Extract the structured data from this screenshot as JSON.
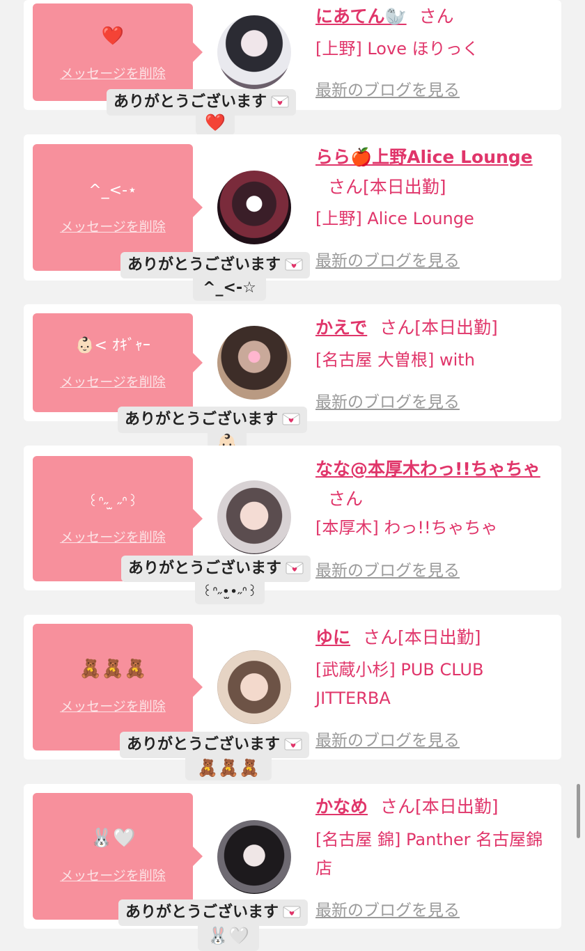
{
  "delete_label": "メッセージを削除",
  "san": "さん",
  "blog_label": "最新のブログを見る",
  "thanks_label": "ありがとうございます",
  "colors": {
    "accent": "#e0356a",
    "bubble": "#f7909c",
    "link_gray": "#9a9a9a"
  },
  "items": [
    {
      "bubble": "❤️",
      "name": "にあてん🦭",
      "status": "",
      "shop": "[上野] Love ほりっく",
      "reply": "❤️"
    },
    {
      "bubble": "^_<-⋆",
      "name": "らら🍎上野Alice Lounge",
      "status": "[本日出勤]",
      "shop": "[上野] Alice Lounge",
      "reply": "^_<-☆"
    },
    {
      "bubble": "👶🏻< ｵｷﾞｬｰ",
      "name": "かえで",
      "status": "[本日出勤]",
      "shop": "[名古屋 大曽根] with",
      "reply": "👶🏻"
    },
    {
      "bubble": "꒰ᐢ˶ ̫ ˶ᐢ꒱",
      "name": "なな@本厚木わっ!!ちゃちゃ",
      "status": "",
      "shop": "[本厚木] わっ!!ちゃちゃ",
      "reply": "꒰ᐢ˶•̫•˶ᐢ꒱"
    },
    {
      "bubble": "🧸🧸🧸",
      "name": "ゆに",
      "status": "[本日出勤]",
      "shop": "[武蔵小杉] PUB CLUB JITTERBA",
      "reply": "🧸🧸🧸"
    },
    {
      "bubble": "🐰🤍",
      "name": "かなめ",
      "status": "[本日出勤]",
      "shop": "[名古屋 錦] Panther 名古屋錦店",
      "reply": "🐰🤍"
    }
  ]
}
